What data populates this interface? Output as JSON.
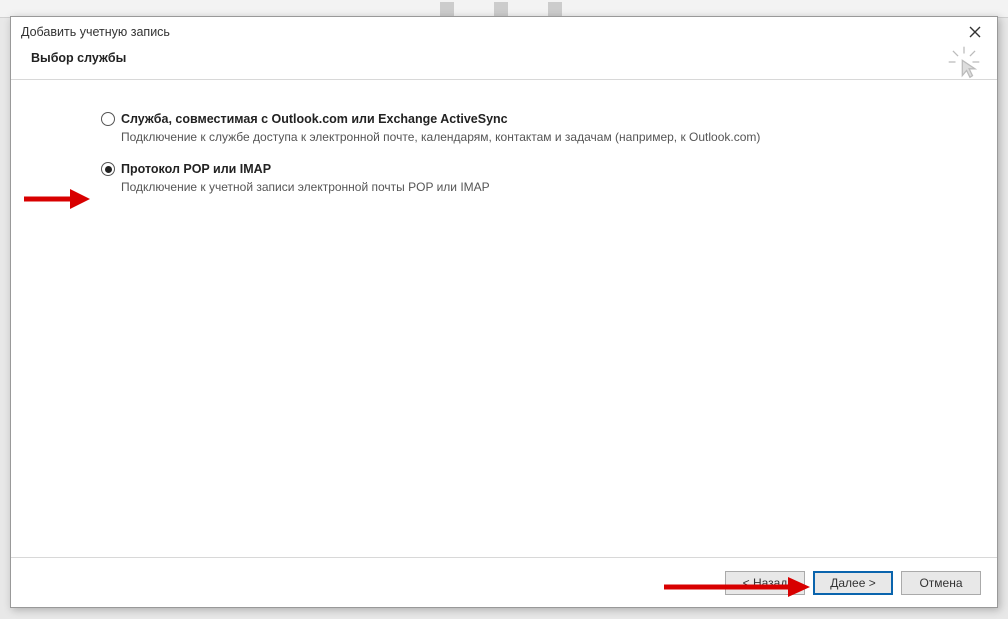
{
  "dialog": {
    "title": "Добавить учетную запись",
    "subtitle": "Выбор службы"
  },
  "options": [
    {
      "label": "Служба, совместимая с Outlook.com или Exchange ActiveSync",
      "description": "Подключение к службе доступа к электронной почте, календарям, контактам и задачам (например, к Outlook.com)",
      "selected": false
    },
    {
      "label": "Протокол POP или IMAP",
      "description": "Подключение к учетной записи электронной почты POP или IMAP",
      "selected": true
    }
  ],
  "buttons": {
    "back": "< Назад",
    "next": "Далее >",
    "cancel": "Отмена"
  }
}
